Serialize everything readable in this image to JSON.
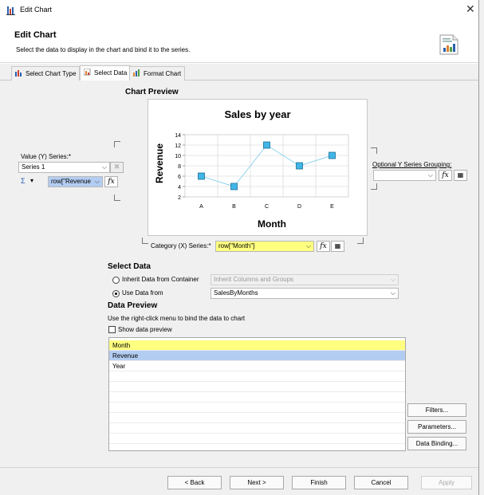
{
  "window": {
    "title": "Edit Chart",
    "close_glyph": "✕"
  },
  "header": {
    "title": "Edit Chart",
    "subtitle": "Select the data to display in the chart and bind it to the series."
  },
  "tabs": [
    {
      "label": "Select Chart Type",
      "icon": "chart-type-icon"
    },
    {
      "label": "Select Data",
      "icon": "select-data-icon",
      "active": true
    },
    {
      "label": "Format Chart",
      "icon": "format-chart-icon"
    }
  ],
  "chart_preview": {
    "section_label": "Chart Preview"
  },
  "value_series": {
    "label": "Value (Y) Series:*",
    "series_select": "Series 1",
    "sigma": "Σ",
    "expression": "row[\"Revenue",
    "fx": "fx"
  },
  "optional_grouping": {
    "label": "Optional Y Series Grouping:",
    "value": "",
    "fx": "fx"
  },
  "category_series": {
    "label": "Category (X) Series:*",
    "expression": "row[\"Month\"]",
    "fx": "fx"
  },
  "select_data": {
    "section_label": "Select Data",
    "inherit_label": "Inherit Data from Container",
    "inherit_value": "Inherit Columns and Groups",
    "use_label": "Use Data from",
    "use_value": "SalesByMonths",
    "selected": "use"
  },
  "data_preview": {
    "section_label": "Data Preview",
    "hint": "Use the right-click menu to bind the data to chart",
    "show_label": "Show data preview",
    "show_checked": false,
    "rows": [
      {
        "text": "Month",
        "highlight": "yellow"
      },
      {
        "text": "Revenue",
        "highlight": "blue"
      },
      {
        "text": "Year",
        "highlight": "none"
      }
    ]
  },
  "side_buttons": {
    "filters": "Filters...",
    "parameters": "Parameters...",
    "data_binding": "Data Binding..."
  },
  "footer": {
    "back": "< Back",
    "next": "Next >",
    "finish": "Finish",
    "cancel": "Cancel",
    "apply": "Apply"
  },
  "colors": {
    "yellow_highlight": "#ffff80",
    "blue_highlight": "#b3cdf2",
    "series_line": "#8fd3ee",
    "marker_fill": "#41b6e6"
  },
  "chart_data": {
    "type": "line",
    "title": "Sales by year",
    "xlabel": "Month",
    "ylabel": "Revenue",
    "categories": [
      "A",
      "B",
      "C",
      "D",
      "E"
    ],
    "values": [
      6,
      4,
      12,
      8,
      10
    ],
    "ylim": [
      2,
      14
    ],
    "yticks": [
      2,
      4,
      6,
      8,
      10,
      12,
      14
    ],
    "grid": true,
    "marker": "square"
  }
}
